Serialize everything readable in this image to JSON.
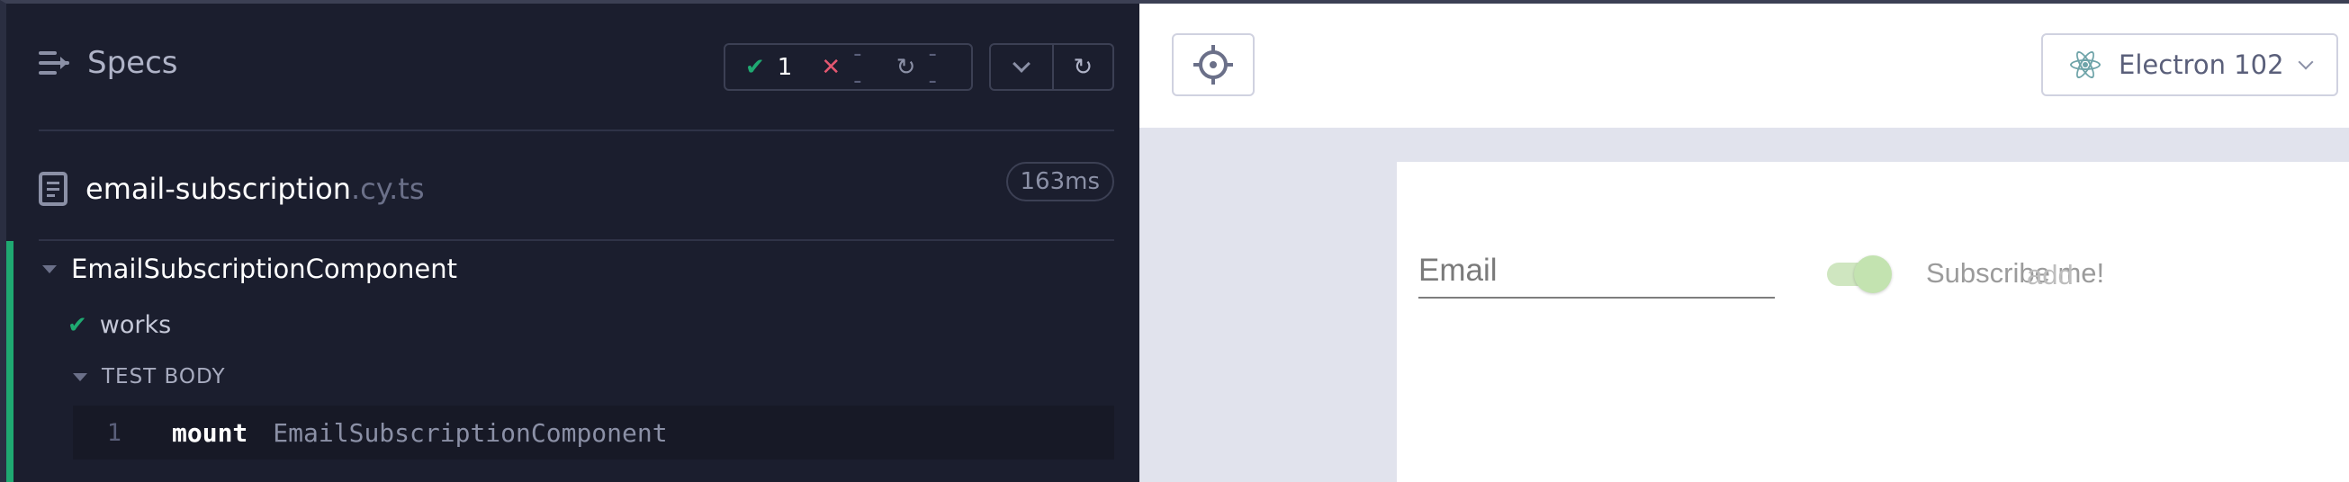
{
  "reporter": {
    "header": {
      "title": "Specs",
      "icon": "specs-list-icon"
    },
    "stats": {
      "passed": {
        "glyph": "✔",
        "value": "1"
      },
      "failed": {
        "glyph": "✕",
        "value": "--"
      },
      "pending": {
        "glyph": "↻",
        "value": "--"
      }
    },
    "controls": {
      "collapse_icon": "chevron-down-icon",
      "rerun_icon": "refresh-icon",
      "rerun_glyph": "↻"
    },
    "file": {
      "name": "email-subscription",
      "ext": ".cy.ts",
      "duration": "163ms"
    },
    "suite": {
      "name": "EmailSubscriptionComponent",
      "status_color": "#1fa971"
    },
    "test": {
      "glyph": "✔",
      "name": "works",
      "section_label": "TEST BODY"
    },
    "commands": [
      {
        "num": "1",
        "name": "mount",
        "arg": "EmailSubscriptionComponent"
      }
    ]
  },
  "aut": {
    "selector_playground_icon": "crosshair-icon",
    "browser": {
      "icon": "electron-icon",
      "label": "Electron 102"
    },
    "app": {
      "email_placeholder": "Email",
      "toggle_label": "Subscribe me!",
      "toggle_on": true,
      "add_label": "add"
    }
  },
  "colors": {
    "reporter_bg": "#1b1e2e",
    "pass": "#1fa971",
    "fail": "#e45770",
    "aut_bg": "#e1e3ed"
  }
}
